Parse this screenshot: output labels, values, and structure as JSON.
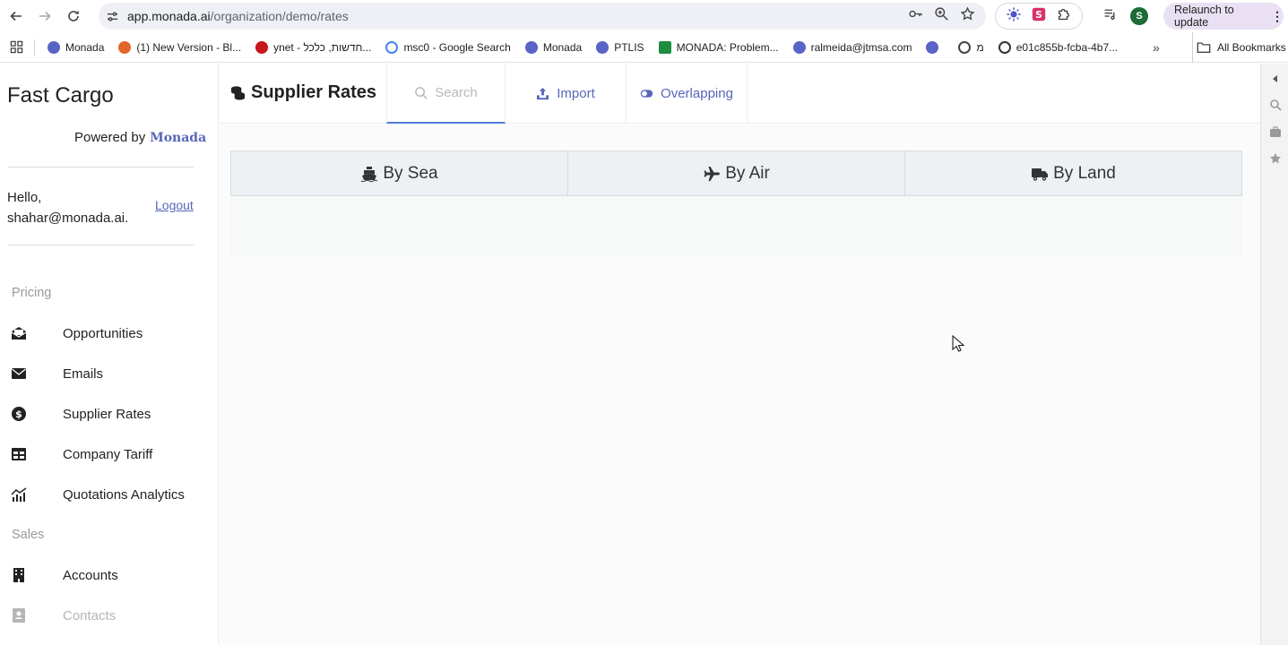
{
  "browser": {
    "url_host": "app.monada.ai",
    "url_path": "/organization/demo/rates",
    "profile_initial": "S",
    "relaunch_label": "Relaunch to update",
    "bookmarks": [
      {
        "label": "Monada",
        "color": "#5a63c6"
      },
      {
        "label": "(1) New Version - Bl...",
        "color": "#e0662a"
      },
      {
        "label": "ynet - חדשות, כלכל...",
        "color": "#c9151c"
      },
      {
        "label": "msc0 - Google Search",
        "color": "#4285f4"
      },
      {
        "label": "Monada",
        "color": "#5a63c6"
      },
      {
        "label": "PTLIS",
        "color": "#5a63c6"
      },
      {
        "label": "MONADA: Problem...",
        "color": "#1e8e3e"
      },
      {
        "label": "ralmeida@jtmsa.com",
        "color": "#5a63c6"
      },
      {
        "label": "",
        "color": "#5a63c6"
      },
      {
        "label": "מ",
        "color": "#444444"
      },
      {
        "label": "e01c855b-fcba-4b7...",
        "color": "#333333"
      }
    ],
    "all_bookmarks_label": "All Bookmarks"
  },
  "sidebar": {
    "brand": "Fast Cargo",
    "powered_by": "Powered by",
    "powered_logo": "Monada",
    "greeting": "Hello,",
    "user_email": "shahar@monada.ai.",
    "logout_label": "Logout",
    "sections": [
      {
        "label": "Pricing"
      },
      {
        "label": "Sales"
      }
    ],
    "items": [
      {
        "label": "Opportunities",
        "icon": "envelope-open-icon"
      },
      {
        "label": "Emails",
        "icon": "envelope-icon"
      },
      {
        "label": "Supplier Rates",
        "icon": "dollar-circle-icon"
      },
      {
        "label": "Company Tariff",
        "icon": "table-icon"
      },
      {
        "label": "Quotations Analytics",
        "icon": "chart-icon"
      },
      {
        "label": "Accounts",
        "icon": "building-icon"
      },
      {
        "label": "Contacts",
        "icon": "contact-card-icon"
      }
    ]
  },
  "header": {
    "title": "Supplier Rates",
    "tabs": [
      {
        "label": "Search"
      },
      {
        "label": "Import"
      },
      {
        "label": "Overlapping"
      }
    ]
  },
  "modes": [
    {
      "label": "By Sea",
      "icon": "ship-icon"
    },
    {
      "label": "By Air",
      "icon": "plane-icon"
    },
    {
      "label": "By Land",
      "icon": "truck-icon"
    }
  ],
  "colors": {
    "accent": "#5866b8",
    "active_tab_underline": "#4f7bd9"
  }
}
